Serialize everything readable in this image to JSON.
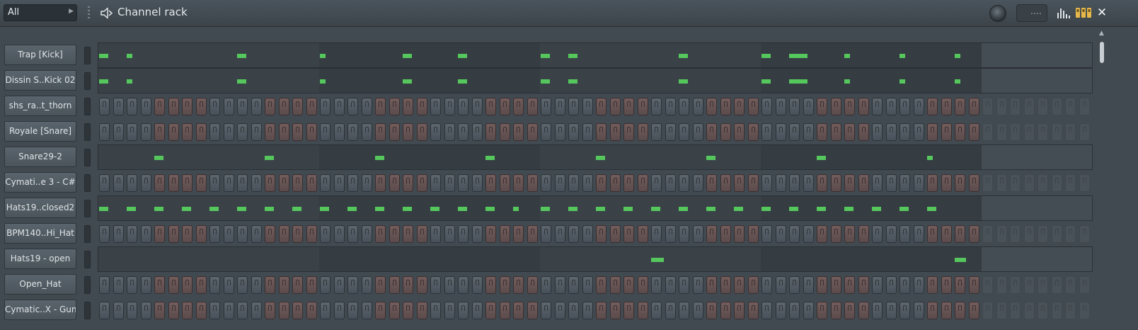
{
  "header": {
    "filter_label": "All",
    "title": "Channel rack",
    "icons": [
      "speaker-icon",
      "swing-knob",
      "graph-icon",
      "step-sequencer-icon",
      "close-icon"
    ],
    "close_label": "✕"
  },
  "colors": {
    "note": "#55c75d",
    "pad_gray": "#5d666d",
    "pad_red": "#735d5c"
  },
  "step_pattern": {
    "total_steps": 72,
    "active_steps": 64,
    "red_groups": [
      4,
      12,
      20,
      28,
      36,
      44,
      52,
      60
    ]
  },
  "channels": [
    {
      "name": "Trap [Kick]",
      "mode": "piano",
      "notes": [
        [
          0,
          0.8
        ],
        [
          2,
          0.5
        ],
        [
          10,
          0.8
        ],
        [
          16,
          0.5
        ],
        [
          22,
          0.8
        ],
        [
          26,
          0.8
        ],
        [
          32,
          0.8
        ],
        [
          34,
          0.8
        ],
        [
          42,
          0.8
        ],
        [
          48,
          0.8
        ],
        [
          50,
          1.6
        ],
        [
          54,
          0.5
        ],
        [
          58,
          0.5
        ],
        [
          62,
          0.5
        ]
      ]
    },
    {
      "name": "Dissin S..Kick 02",
      "mode": "piano",
      "notes": [
        [
          0,
          0.8
        ],
        [
          2,
          0.5
        ],
        [
          10,
          0.8
        ],
        [
          16,
          0.5
        ],
        [
          22,
          0.8
        ],
        [
          26,
          0.8
        ],
        [
          32,
          0.8
        ],
        [
          34,
          0.8
        ],
        [
          42,
          0.8
        ],
        [
          48,
          0.8
        ],
        [
          50,
          1.6
        ],
        [
          54,
          0.5
        ],
        [
          58,
          0.5
        ],
        [
          62,
          0.5
        ]
      ]
    },
    {
      "name": "shs_ra..t_thorn",
      "mode": "steps"
    },
    {
      "name": "Royale [Snare]",
      "mode": "steps"
    },
    {
      "name": "Snare29-2",
      "mode": "piano",
      "notes": [
        [
          4,
          0.8
        ],
        [
          12,
          0.8
        ],
        [
          20,
          0.8
        ],
        [
          28,
          0.8
        ],
        [
          36,
          0.8
        ],
        [
          44,
          0.8
        ],
        [
          52,
          0.8
        ],
        [
          60,
          0.5
        ]
      ]
    },
    {
      "name": "Cymati..e 3 - C#",
      "mode": "steps"
    },
    {
      "name": "Hats19..closed2",
      "mode": "piano",
      "notes": [
        [
          0,
          0.8
        ],
        [
          2,
          0.8
        ],
        [
          4,
          0.8
        ],
        [
          6,
          0.8
        ],
        [
          8,
          0.8
        ],
        [
          10,
          0.8
        ],
        [
          12,
          0.8
        ],
        [
          14,
          0.8
        ],
        [
          16,
          0.8
        ],
        [
          18,
          0.8
        ],
        [
          20,
          0.8
        ],
        [
          22,
          0.8
        ],
        [
          24,
          0.8
        ],
        [
          26,
          0.8
        ],
        [
          28,
          0.8
        ],
        [
          30,
          0.5
        ],
        [
          32,
          0.8
        ],
        [
          34,
          0.8
        ],
        [
          36,
          0.8
        ],
        [
          38,
          0.8
        ],
        [
          40,
          0.8
        ],
        [
          42,
          0.8
        ],
        [
          44,
          0.8
        ],
        [
          46,
          0.8
        ],
        [
          48,
          0.8
        ],
        [
          50,
          0.8
        ],
        [
          52,
          0.8
        ],
        [
          54,
          0.8
        ],
        [
          56,
          0.8
        ],
        [
          58,
          0.8
        ],
        [
          60,
          0.8
        ]
      ]
    },
    {
      "name": "BPM140..Hi_Hat",
      "mode": "steps"
    },
    {
      "name": "Hats19 - open",
      "mode": "piano",
      "notes": [
        [
          40,
          1.1
        ],
        [
          62,
          1.0
        ]
      ]
    },
    {
      "name": "Open_Hat",
      "mode": "steps"
    },
    {
      "name": "Cymatic..X - Gun",
      "mode": "steps"
    }
  ]
}
